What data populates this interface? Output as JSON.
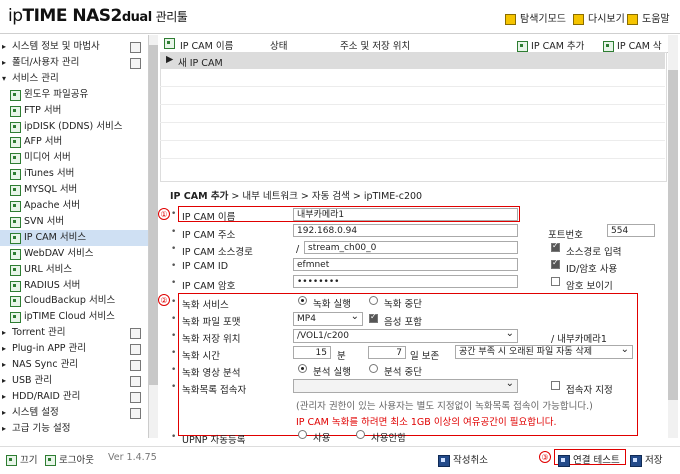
{
  "app": {
    "brand_ip": "ip",
    "brand_time": "TIME",
    "model": "NAS2",
    "model_sub": "dual",
    "admin": "관리툴"
  },
  "toplinks": [
    "탐색기모드",
    "다시보기",
    "도움말"
  ],
  "sidebar": [
    {
      "label": "시스템 정보 및 마법사",
      "tri": "▸",
      "indent": 0
    },
    {
      "label": "폴더/사용자 관리",
      "tri": "▸",
      "indent": 0
    },
    {
      "label": "서비스 관리",
      "tri": "▾",
      "indent": 0
    },
    {
      "label": "윈도우 파일공유",
      "indent": 1
    },
    {
      "label": "FTP 서버",
      "indent": 1
    },
    {
      "label": "ipDISK (DDNS) 서비스",
      "indent": 1
    },
    {
      "label": "AFP 서버",
      "indent": 1
    },
    {
      "label": "미디어 서버",
      "indent": 1
    },
    {
      "label": "iTunes 서버",
      "indent": 1
    },
    {
      "label": "MYSQL 서버",
      "indent": 1
    },
    {
      "label": "Apache 서버",
      "indent": 1
    },
    {
      "label": "SVN 서버",
      "indent": 1
    },
    {
      "label": "IP CAM 서비스",
      "indent": 1,
      "active": true
    },
    {
      "label": "WebDAV 서비스",
      "indent": 1
    },
    {
      "label": "URL 서비스",
      "indent": 1
    },
    {
      "label": "RADIUS 서버",
      "indent": 1
    },
    {
      "label": "CloudBackup 서비스",
      "indent": 1
    },
    {
      "label": "ipTIME Cloud 서비스",
      "indent": 1
    },
    {
      "label": "Torrent 관리",
      "tri": "▸",
      "indent": 0
    },
    {
      "label": "Plug-in APP 관리",
      "tri": "▸",
      "indent": 0
    },
    {
      "label": "NAS Sync 관리",
      "tri": "▸",
      "indent": 0
    },
    {
      "label": "USB 관리",
      "tri": "▸",
      "indent": 0
    },
    {
      "label": "HDD/RAID 관리",
      "tri": "▸",
      "indent": 0
    },
    {
      "label": "시스템 설정",
      "tri": "▸",
      "indent": 0
    },
    {
      "label": "고급 기능 설정",
      "tri": "▸",
      "indent": 0
    }
  ],
  "footer": {
    "exit": "끄기",
    "logout": "로그아웃",
    "version": "Ver 1.4.75",
    "cancel": "작성취소",
    "test": "연결 테스트",
    "save": "저장"
  },
  "list": {
    "col_name": "IP CAM 이름",
    "col_status": "상태",
    "col_path": "주소 및 저장 위치",
    "add": "IP CAM 추가",
    "delete": "IP CAM 삭제",
    "new_row": "새 IP CAM"
  },
  "breadcrumb": {
    "bold": "IP CAM 추가",
    "rest": " > 내부 네트워크 > 자동 검색 > ipTIME-c200"
  },
  "form": {
    "name_label": "IP CAM 이름",
    "name_value": "내부카메라1",
    "addr_label": "IP CAM 주소",
    "addr_value": "192.168.0.94",
    "port_label": "포트번호",
    "port_value": "554",
    "src_label": "IP CAM 소스경로",
    "src_slash": "/",
    "src_value": "stream_ch00_0",
    "src_input_label": "소스경로 입력",
    "id_label": "IP CAM ID",
    "id_value": "efmnet",
    "id_pw_label": "ID/암호 사용",
    "pw_label": "IP CAM 암호",
    "pw_value": "••••••••",
    "show_pw_label": "암호 보이기",
    "rec_service_label": "녹화 서비스",
    "rec_run": "녹화 실행",
    "rec_stop": "녹화 중단",
    "format_label": "녹화 파일 포맷",
    "format_value": "MP4",
    "audio_label": "음성 포함",
    "loc_label": "녹화 저장 위치",
    "loc_value": "/VOL1/c200",
    "loc_suffix": "/ 내부카메라1",
    "time_label": "녹화 시간",
    "time_min": "15",
    "min_unit": "분",
    "time_days": "7",
    "day_unit": "일 보존",
    "retention_value": "공간 부족 시 오래된 파일 자동 삭제",
    "analysis_label": "녹화 영상 분석",
    "analysis_run": "분석 실행",
    "analysis_stop": "분석 중단",
    "viewer_label": "녹화목록 접속자",
    "viewer_specify": "접속자 지정",
    "note": "(관리자 권한이 있는 사용자는 별도 지정없이 녹화목록 접속이 가능합니다.)",
    "warning": "IP CAM 녹화를 하려면 최소 1GB 이상의 여유공간이 필요합니다.",
    "upnp_label": "UPNP 자동등록",
    "upnp_use": "사용",
    "upnp_nouse": "사용안함"
  },
  "badges": [
    "①",
    "②",
    "③"
  ],
  "colors": {
    "highlight": "#e00000",
    "warning_text": "#e00000",
    "active_row": "#cfe0f3"
  }
}
